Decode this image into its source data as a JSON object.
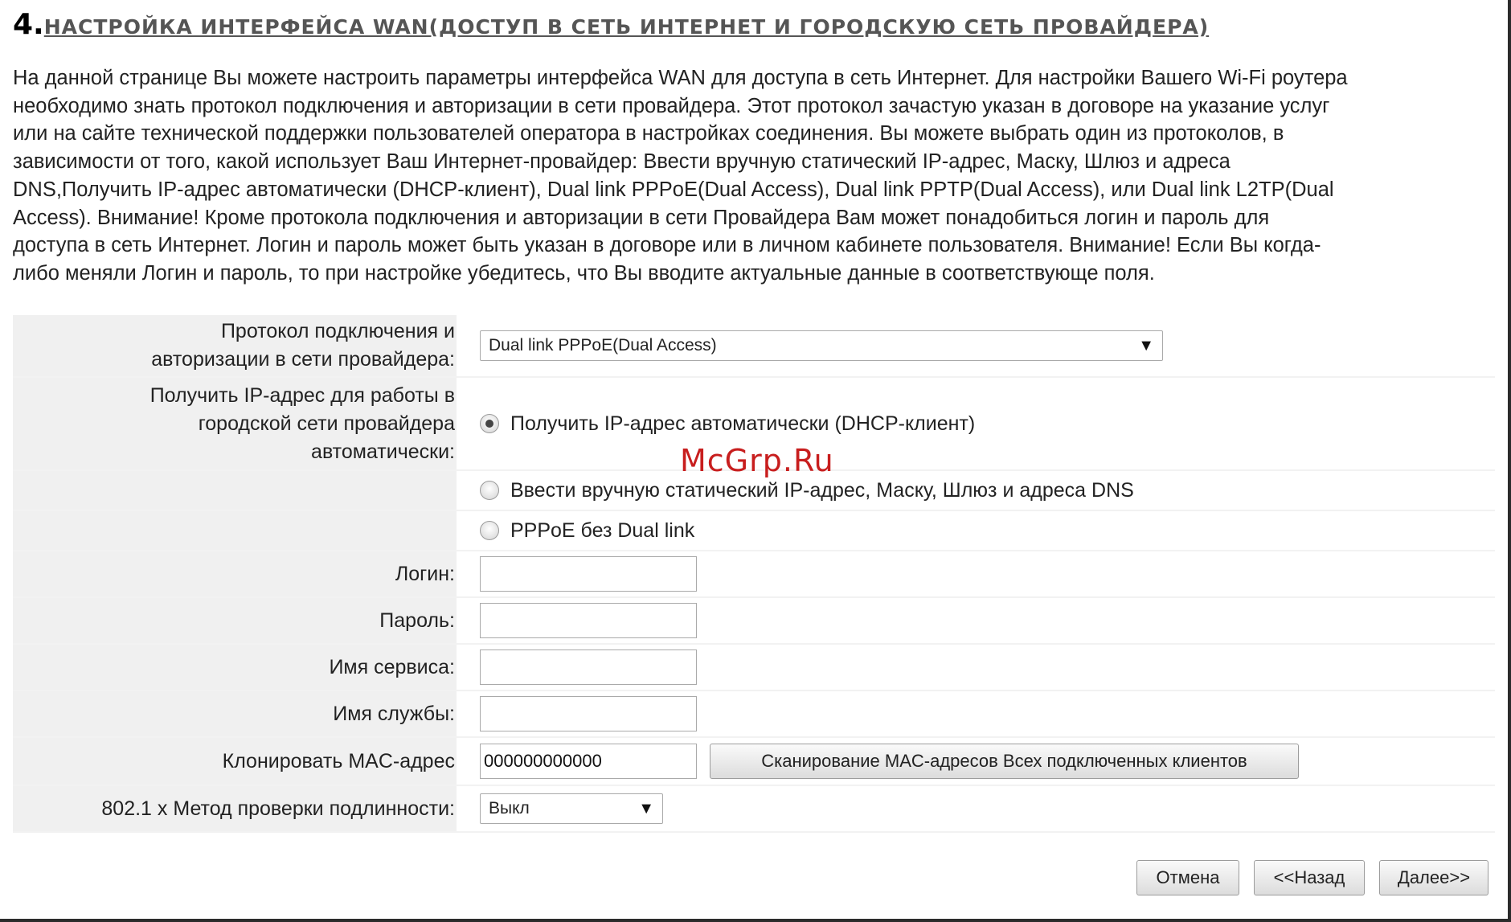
{
  "header": {
    "number": "4.",
    "title": "НАСТРОЙКА ИНТЕРФЕЙСА WAN(ДОСТУП В СЕТЬ ИНТЕРНЕТ И ГОРОДСКУЮ СЕТЬ ПРОВАЙДЕРА)"
  },
  "description": {
    "lines": [
      "На данной странице Вы можете настроить параметры интерфейса WAN для доступа в сеть Интернет. Для настройки Вашего Wi-Fi роутера",
      "необходимо знать протокол подключения и авторизации в сети провайдера. Этот протокол зачастую указан в договоре на указание услуг",
      "или на сайте технической поддержки пользователей оператора в настройках соединения. Вы можете выбрать один из протоколов, в",
      "зависимости от того, какой использует Ваш Интернет-провайдер: Ввести вручную статический IP-адрес, Маску, Шлюз и адреса",
      "DNS,Получить IP-адрес автоматически (DHCP-клиент), Dual link PPPoE(Dual Access), Dual link PPTP(Dual Access), или Dual link L2TP(Dual",
      "Access). Внимание! Кроме протокола подключения и авторизации в сети Провайдера Вам может понадобиться логин и пароль для",
      "доступа в сеть Интернет. Логин и пароль может быть указан в договоре или в личном кабинете пользователя. Внимание! Если Вы когда-",
      "либо меняли Логин и пароль, то при настройке убедитесь, что Вы вводите актуальные данные в соответствующе поля."
    ]
  },
  "form": {
    "protocol": {
      "label_line1": "Протокол подключения и",
      "label_line2": "авторизации в сети провайдера:",
      "selected": "Dual link PPPoE(Dual Access)",
      "caret": "▼"
    },
    "ip_mode": {
      "label_line1": "Получить IP-адрес для работы в",
      "label_line2": "городской сети провайдера",
      "label_line3": "автоматически:",
      "options": [
        {
          "label": "Получить IP-адрес автоматически (DHCP-клиент)",
          "checked": true
        },
        {
          "label": "Ввести вручную статический IP-адрес, Маску, Шлюз и адреса DNS",
          "checked": false
        },
        {
          "label": "PPPoE без Dual link",
          "checked": false
        }
      ]
    },
    "login": {
      "label": "Логин:",
      "value": ""
    },
    "password": {
      "label": "Пароль:",
      "value": ""
    },
    "service_name": {
      "label": "Имя сервиса:",
      "value": ""
    },
    "service": {
      "label": "Имя службы:",
      "value": ""
    },
    "mac_clone": {
      "label": "Клонировать MAC-адрес",
      "value": "000000000000",
      "scan_button": "Сканирование MAC-адресов Всех подключенных клиентов"
    },
    "auth_8021x": {
      "label": "802.1 x Метод проверки подлинности:",
      "selected": "Выкл",
      "caret": "▼"
    }
  },
  "buttons": {
    "cancel": "Отмена",
    "back": "<<Назад",
    "next": "Далее>>"
  },
  "watermark": "McGrp.Ru"
}
